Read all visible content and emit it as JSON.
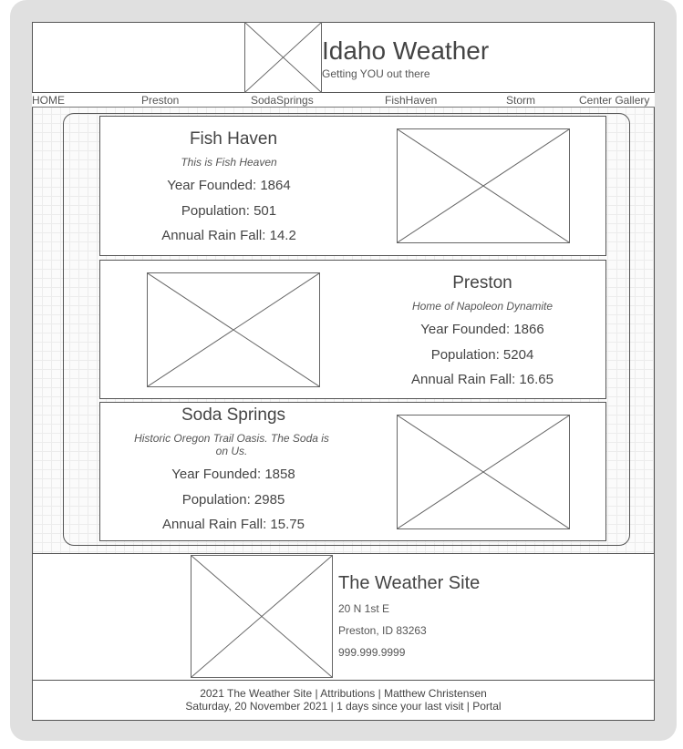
{
  "header": {
    "title": "Idaho Weather",
    "tagline": "Getting YOU out there"
  },
  "nav": {
    "items": [
      {
        "label": "HOME"
      },
      {
        "label": "Preston"
      },
      {
        "label": "SodaSprings"
      },
      {
        "label": "FishHaven"
      },
      {
        "label": "Storm"
      },
      {
        "label": "Center Gallery"
      }
    ]
  },
  "towns": [
    {
      "name": "Fish Haven",
      "motto": "This is Fish Heaven",
      "year_founded": "Year Founded: 1864",
      "population": "Population: 501",
      "rainfall": "Annual Rain Fall: 14.2"
    },
    {
      "name": "Preston",
      "motto": "Home of Napoleon Dynamite",
      "year_founded": "Year Founded: 1866",
      "population": "Population: 5204",
      "rainfall": "Annual Rain Fall: 16.65"
    },
    {
      "name": "Soda Springs",
      "motto": "Historic Oregon Trail Oasis. The Soda is on Us.",
      "year_founded": "Year Founded: 1858",
      "population": "Population: 2985",
      "rainfall": "Annual Rain Fall: 15.75"
    }
  ],
  "footer": {
    "title": "The Weather Site",
    "address1": "20 N 1st E",
    "address2": "Preston, ID 83263",
    "phone": "999.999.9999"
  },
  "bottom": {
    "line1": "2021 The Weather Site | Attributions | Matthew Christensen",
    "line2": "Saturday, 20 November 2021 | 1 days since your last visit | Portal"
  }
}
